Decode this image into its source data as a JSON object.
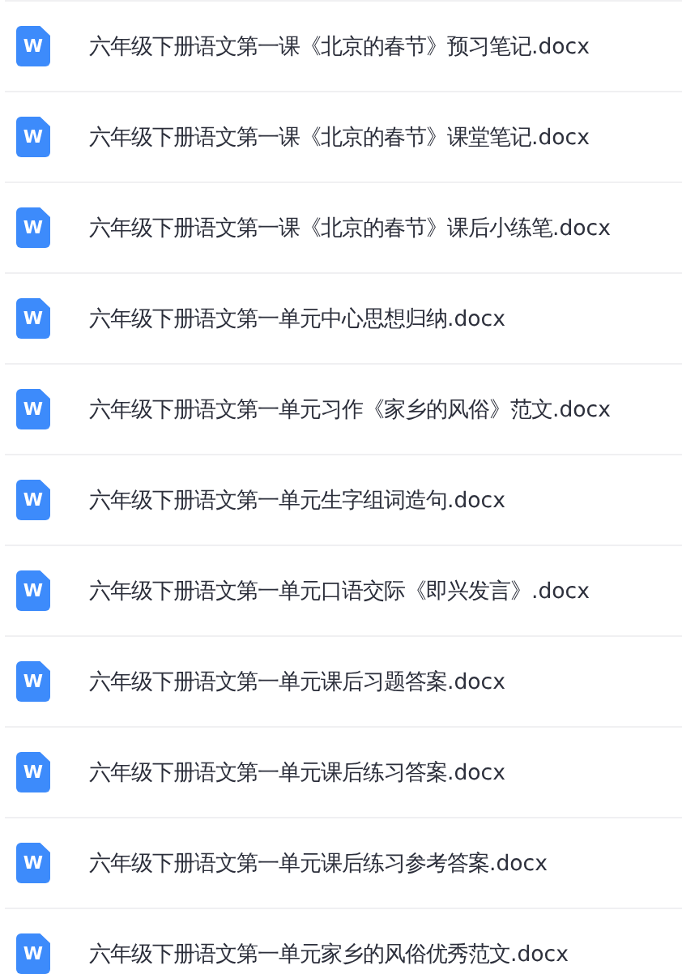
{
  "files": [
    {
      "name": "六年级下册语文第一课《北京的春节》预习笔记.docx",
      "icon_letter": "W"
    },
    {
      "name": "六年级下册语文第一课《北京的春节》课堂笔记.docx",
      "icon_letter": "W"
    },
    {
      "name": "六年级下册语文第一课《北京的春节》课后小练笔.docx",
      "icon_letter": "W"
    },
    {
      "name": "六年级下册语文第一单元中心思想归纳.docx",
      "icon_letter": "W"
    },
    {
      "name": "六年级下册语文第一单元习作《家乡的风俗》范文.docx",
      "icon_letter": "W"
    },
    {
      "name": "六年级下册语文第一单元生字组词造句.docx",
      "icon_letter": "W"
    },
    {
      "name": "六年级下册语文第一单元口语交际《即兴发言》.docx",
      "icon_letter": "W"
    },
    {
      "name": "六年级下册语文第一单元课后习题答案.docx",
      "icon_letter": "W"
    },
    {
      "name": "六年级下册语文第一单元课后练习答案.docx",
      "icon_letter": "W"
    },
    {
      "name": "六年级下册语文第一单元课后练习参考答案.docx",
      "icon_letter": "W"
    },
    {
      "name": "六年级下册语文第一单元家乡的风俗优秀范文.docx",
      "icon_letter": "W"
    }
  ]
}
